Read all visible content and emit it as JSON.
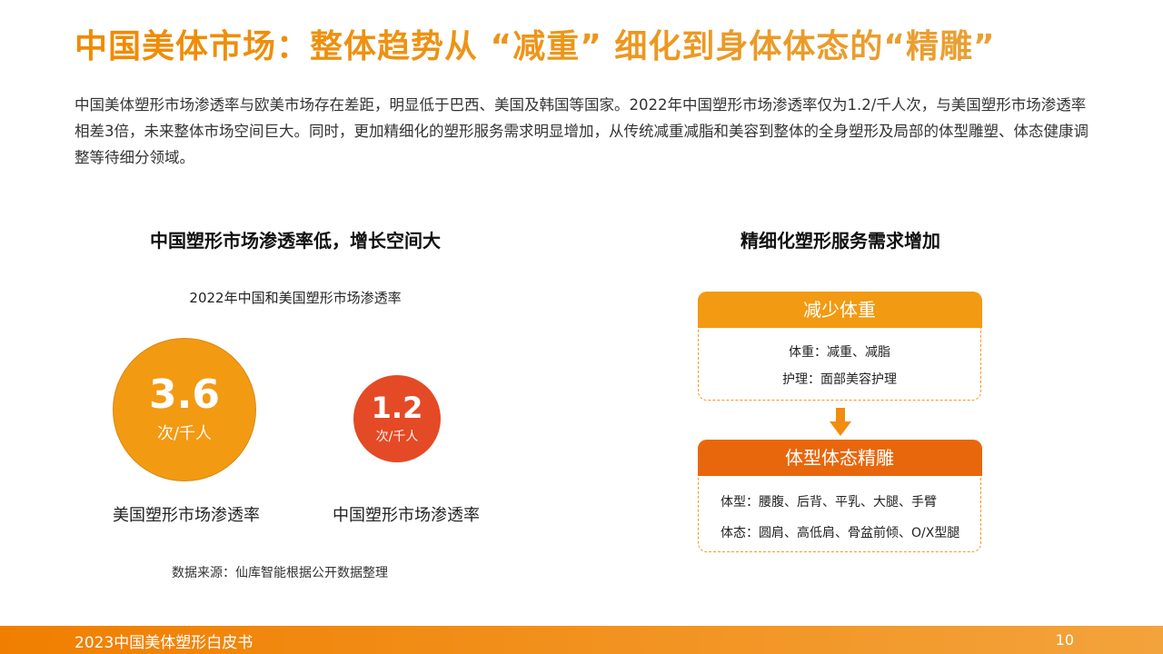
{
  "page": {
    "title": "中国美体市场：整体趋势从 “减重” 细化到身体体态的“精雕”",
    "intro": "中国美体塑形市场渗透率与欧美市场存在差距，明显低于巴西、美国及韩国等国家。2022年中国塑形市场渗透率仅为1.2/千人次，与美国塑形市场渗透率相差3倍，未来整体市场空间巨大。同时，更加精细化的塑形服务需求明显增加，从传统减重减脂和美容到整体的全身塑形及局部的体型雕塑、体态健康调整等待细分领域。"
  },
  "left": {
    "heading": "中国塑形市场渗透率低，增长空间大",
    "source": "数据来源：仙库智能根据公开数据整理"
  },
  "chart_data": {
    "type": "bubble",
    "title": "2022年中国和美国塑形市场渗透率",
    "unit": "次/千人",
    "items": [
      {
        "label": "美国塑形市场渗透率",
        "value": 3.6,
        "value_text": "3.6",
        "color": "#f29a12"
      },
      {
        "label": "中国塑形市场渗透率",
        "value": 1.2,
        "value_text": "1.2",
        "color": "#e44a26"
      }
    ]
  },
  "right": {
    "heading": "精细化塑形服务需求增加",
    "box1": {
      "title": "减少体重",
      "line1": "体重：减重、减脂",
      "line2": "护理：面部美容护理",
      "color": "#f29a12"
    },
    "box2": {
      "title": "体型体态精雕",
      "line1": "体型：腰腹、后背、平乳、大腿、手臂",
      "line2": "体态：圆肩、高低肩、骨盆前倾、O/X型腿",
      "color": "#e8670c"
    },
    "arrow_icon": "arrow-down-icon"
  },
  "footer": {
    "text": "2023中国美体塑形白皮书",
    "page_number": "10"
  }
}
